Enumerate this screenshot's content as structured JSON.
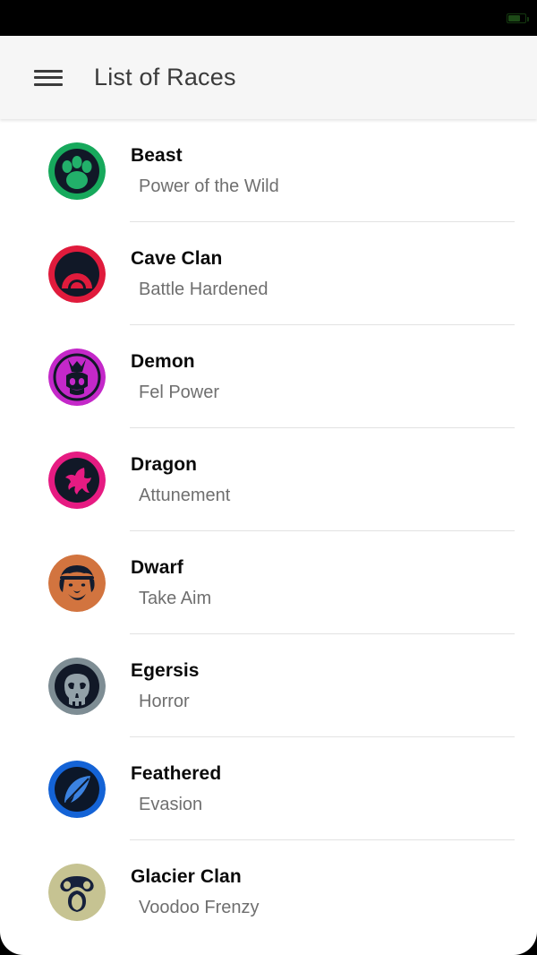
{
  "status_bar": {
    "battery_icon": "battery-icon",
    "battery_color": "#1d4a17"
  },
  "appbar": {
    "menu_icon": "hamburger-menu-icon",
    "title": "List of Races",
    "background": "#f6f6f6",
    "title_color": "#3b3b3b"
  },
  "races": [
    {
      "name": "Beast",
      "trait": "Power of the Wild",
      "icon": "paw-print-icon",
      "ring": "#17a95c",
      "fill": "#111827",
      "mark": "#22b06a"
    },
    {
      "name": "Cave Clan",
      "trait": "Battle Hardened",
      "icon": "cave-arch-icon",
      "ring": "#e01b3c",
      "fill": "#111827",
      "mark": "#e01b3c"
    },
    {
      "name": "Demon",
      "trait": "Fel Power",
      "icon": "horned-skull-icon",
      "ring": "#c428c9",
      "fill": "#111827",
      "mark": "#c428c9"
    },
    {
      "name": "Dragon",
      "trait": "Attunement",
      "icon": "dragon-icon",
      "ring": "#e61b82",
      "fill": "#111827",
      "mark": "#e61b82"
    },
    {
      "name": "Dwarf",
      "trait": "Take Aim",
      "icon": "dwarf-face-icon",
      "ring": "#d2743f",
      "fill": "#d2743f",
      "mark": "#131c2e"
    },
    {
      "name": "Egersis",
      "trait": "Horror",
      "icon": "skull-icon",
      "ring": "#7e8d94",
      "fill": "#111827",
      "mark": "#93a1a8"
    },
    {
      "name": "Feathered",
      "trait": "Evasion",
      "icon": "feather-icon",
      "ring": "#1463d6",
      "fill": "#0c1729",
      "mark": "#3b82e0"
    },
    {
      "name": "Glacier Clan",
      "trait": "Voodoo Frenzy",
      "icon": "tribal-mask-icon",
      "ring": "#c6c392",
      "fill": "#c6c392",
      "mark": "#16213c"
    }
  ]
}
